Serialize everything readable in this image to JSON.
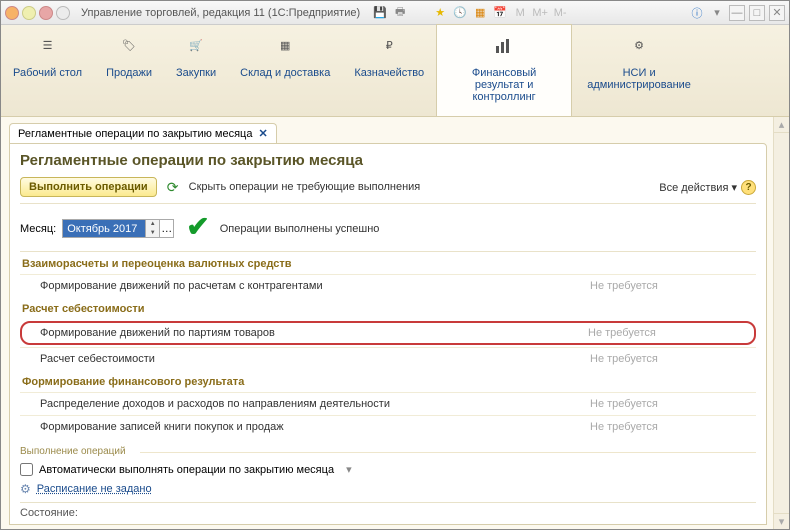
{
  "window": {
    "title": "Управление торговлей, редакция 11  (1С:Предприятие)"
  },
  "sections": [
    {
      "label": "Рабочий стол"
    },
    {
      "label": "Продажи"
    },
    {
      "label": "Закупки"
    },
    {
      "label": "Склад и доставка"
    },
    {
      "label": "Казначейство"
    },
    {
      "label": "Финансовый результат и контроллинг"
    },
    {
      "label": "НСИ и администрирование"
    }
  ],
  "tab": {
    "label": "Регламентные операции по закрытию месяца"
  },
  "page": {
    "title": "Регламентные операции по закрытию месяца",
    "run_button": "Выполнить операции",
    "hide_ops": "Скрыть операции не требующие выполнения",
    "all_actions": "Все действия",
    "month_label": "Месяц:",
    "month_value": "Октябрь 2017",
    "status": "Операции выполнены успешно"
  },
  "groups": [
    {
      "title": "Взаиморасчеты и переоценка валютных средств",
      "ops": [
        {
          "label": "Формирование движений по расчетам с контрагентами",
          "status": "Не требуется",
          "highlight": false
        }
      ]
    },
    {
      "title": "Расчет себестоимости",
      "ops": [
        {
          "label": "Формирование движений по партиям товаров",
          "status": "Не требуется",
          "highlight": true
        },
        {
          "label": "Расчет себестоимости",
          "status": "Не требуется",
          "highlight": false
        }
      ]
    },
    {
      "title": "Формирование финансового результата",
      "ops": [
        {
          "label": "Распределение доходов и расходов по направлениям деятельности",
          "status": "Не требуется",
          "highlight": false
        },
        {
          "label": "Формирование записей книги покупок и продаж",
          "status": "Не требуется",
          "highlight": false
        }
      ]
    }
  ],
  "footer": {
    "group_label": "Выполнение операций",
    "auto_checkbox": "Автоматически выполнять операции по закрытию месяца",
    "schedule_link": "Расписание не задано",
    "status_label": "Состояние:"
  }
}
